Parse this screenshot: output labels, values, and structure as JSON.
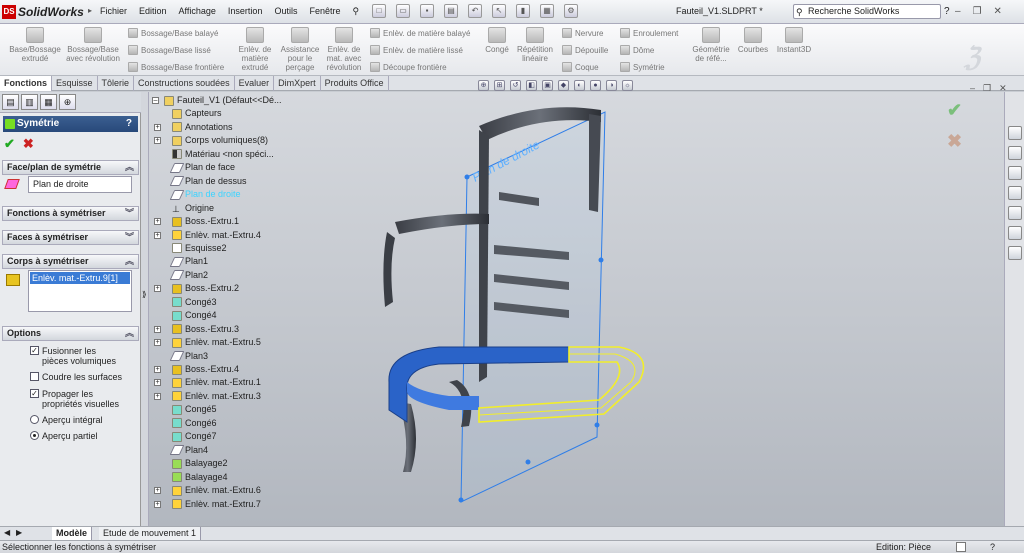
{
  "app": {
    "name": "SolidWorks",
    "doc_title": "Fauteil_V1.SLDPRT *"
  },
  "menus": [
    "Fichier",
    "Edition",
    "Affichage",
    "Insertion",
    "Outils",
    "Fenêtre"
  ],
  "search": {
    "placeholder": "Recherche SolidWorks"
  },
  "ribbon": {
    "big": [
      {
        "label": "Base/Bossage extrudé"
      },
      {
        "label": "Bossage/Base avec révolution"
      },
      {
        "label": "Enlèv. de matière extrudé"
      },
      {
        "label": "Assistance pour le perçage"
      },
      {
        "label": "Enlèv. de mat. avec révolution"
      },
      {
        "label": "Congé"
      },
      {
        "label": "Répétition linéaire"
      },
      {
        "label": "Géométrie de réfé..."
      },
      {
        "label": "Courbes"
      },
      {
        "label": "Instant3D"
      }
    ],
    "small": [
      "Bossage/Base balayé",
      "Bossage/Base lissé",
      "Bossage/Base frontière",
      "Enlèv. de matière balayé",
      "Enlèv. de matière lissé",
      "Découpe frontière",
      "Nervure",
      "Dépouille",
      "Coque",
      "Enroulement",
      "Dôme",
      "Symétrie"
    ]
  },
  "tabs": [
    "Fonctions",
    "Esquisse",
    "Tôlerie",
    "Constructions soudées",
    "Evaluer",
    "DimXpert",
    "Produits Office"
  ],
  "property_manager": {
    "title": "Symétrie",
    "help": "?",
    "groups": {
      "face": "Face/plan de symétrie",
      "features": "Fonctions à symétriser",
      "faces": "Faces à symétriser",
      "bodies": "Corps à symétriser",
      "options": "Options"
    },
    "face_value": "Plan de droite",
    "body_selected": "Enlèv. mat.-Extru.9[1]",
    "options": {
      "merge": "Fusionner les pièces volumiques",
      "knit": "Coudre les surfaces",
      "propagate": "Propager les propriétés visuelles",
      "full_preview": "Aperçu intégral",
      "partial_preview": "Aperçu partiel"
    }
  },
  "tree": [
    {
      "label": "Fauteil_V1  (Défaut<<Dé...",
      "icon": "fold",
      "root": true
    },
    {
      "label": "Capteurs",
      "icon": "fold"
    },
    {
      "label": "Annotations",
      "icon": "fold",
      "exp": true
    },
    {
      "label": "Corps volumiques(8)",
      "icon": "fold",
      "exp": true
    },
    {
      "label": "Matériau <non spéci...",
      "icon": "mat"
    },
    {
      "label": "Plan de face",
      "icon": "plane"
    },
    {
      "label": "Plan de dessus",
      "icon": "plane"
    },
    {
      "label": "Plan de droite",
      "icon": "plane",
      "hl": true
    },
    {
      "label": "Origine",
      "icon": "orig"
    },
    {
      "label": "Boss.-Extru.1",
      "icon": "feat",
      "exp": true
    },
    {
      "label": "Enlèv. mat.-Extru.4",
      "icon": "cut",
      "exp": true
    },
    {
      "label": "Esquisse2",
      "icon": "sketch"
    },
    {
      "label": "Plan1",
      "icon": "plane"
    },
    {
      "label": "Plan2",
      "icon": "plane"
    },
    {
      "label": "Boss.-Extru.2",
      "icon": "feat",
      "exp": true
    },
    {
      "label": "Congé3",
      "icon": "fil"
    },
    {
      "label": "Congé4",
      "icon": "fil"
    },
    {
      "label": "Boss.-Extru.3",
      "icon": "feat",
      "exp": true
    },
    {
      "label": "Enlèv. mat.-Extru.5",
      "icon": "cut",
      "exp": true
    },
    {
      "label": "Plan3",
      "icon": "plane"
    },
    {
      "label": "Boss.-Extru.4",
      "icon": "feat",
      "exp": true
    },
    {
      "label": "Enlèv. mat.-Extru.1",
      "icon": "cut",
      "exp": true
    },
    {
      "label": "Enlèv. mat.-Extru.3",
      "icon": "cut",
      "exp": true
    },
    {
      "label": "Congé5",
      "icon": "fil"
    },
    {
      "label": "Congé6",
      "icon": "fil"
    },
    {
      "label": "Congé7",
      "icon": "fil"
    },
    {
      "label": "Plan4",
      "icon": "plane"
    },
    {
      "label": "Balayage2",
      "icon": "swp"
    },
    {
      "label": "Balayage4",
      "icon": "swp"
    },
    {
      "label": "Enlèv. mat.-Extru.6",
      "icon": "cut",
      "exp": true
    },
    {
      "label": "Enlèv. mat.-Extru.7",
      "icon": "cut",
      "exp": true
    }
  ],
  "viewport": {
    "plane_label": "Plan de droite"
  },
  "model_tabs": [
    "Modèle",
    "Etude de mouvement 1"
  ],
  "status": {
    "message": "Sélectionner les fonctions à symétriser",
    "mode": "Edition: Pièce"
  }
}
